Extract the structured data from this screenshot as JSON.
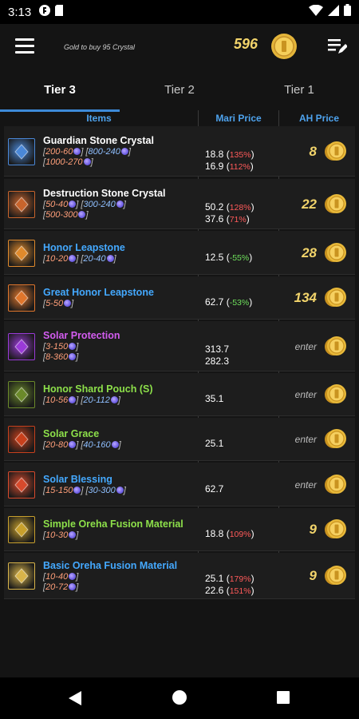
{
  "status": {
    "time": "3:13"
  },
  "header": {
    "subtitle": "Gold to buy 95 Crystal",
    "gold": "596"
  },
  "tabs": [
    {
      "label": "Tier 3",
      "active": true
    },
    {
      "label": "Tier 2",
      "active": false
    },
    {
      "label": "Tier 1",
      "active": false
    }
  ],
  "columns": {
    "items": "Items",
    "mari": "Mari Price",
    "ah": "AH Price"
  },
  "rows": [
    {
      "name": "Guardian Stone Crystal",
      "name_color": "#ffffff",
      "icon": "guardian-stone-crystal-icon",
      "icon_color": "#4a88d8",
      "exch": [
        {
          "a": "200-60",
          "b": "800-240"
        },
        {
          "a": "1000-270",
          "b": ""
        }
      ],
      "mari": [
        {
          "v": "18.8",
          "p": "135%",
          "c": "red"
        },
        {
          "v": "16.9",
          "p": "112%",
          "c": "red"
        }
      ],
      "ah": "8"
    },
    {
      "name": "Destruction Stone Crystal",
      "name_color": "#ffffff",
      "icon": "destruction-stone-crystal-icon",
      "icon_color": "#c8642c",
      "exch": [
        {
          "a": "50-40",
          "b": "300-240"
        },
        {
          "a": "500-300",
          "b": ""
        }
      ],
      "mari": [
        {
          "v": "50.2",
          "p": "128%",
          "c": "red"
        },
        {
          "v": "37.6",
          "p": "71%",
          "c": "red"
        }
      ],
      "ah": "22"
    },
    {
      "name": "Honor Leapstone",
      "name_color": "#44a9ff",
      "icon": "honor-leapstone-icon",
      "icon_color": "#e08a2c",
      "exch": [
        {
          "a": "10-20",
          "b": "20-40"
        }
      ],
      "mari": [
        {
          "v": "12.5",
          "p": "-55%",
          "c": "green"
        }
      ],
      "ah": "28"
    },
    {
      "name": "Great Honor Leapstone",
      "name_color": "#44a9ff",
      "icon": "great-honor-leapstone-icon",
      "icon_color": "#e0762c",
      "exch": [
        {
          "a": "5-50",
          "b": ""
        }
      ],
      "mari": [
        {
          "v": "62.7",
          "p": "-53%",
          "c": "green"
        }
      ],
      "ah": "134"
    },
    {
      "name": "Solar Protection",
      "name_color": "#d35cf0",
      "icon": "solar-protection-icon",
      "icon_color": "#9a3ad8",
      "exch": [
        {
          "a": "3-150",
          "b": ""
        },
        {
          "a": "8-360",
          "b": ""
        }
      ],
      "mari": [
        {
          "v": "313.7",
          "p": "",
          "c": ""
        },
        {
          "v": "282.3",
          "p": "",
          "c": ""
        }
      ],
      "ah": "enter"
    },
    {
      "name": "Honor Shard Pouch (S)",
      "name_color": "#8de04a",
      "icon": "honor-shard-pouch-icon",
      "icon_color": "#6b8a2a",
      "exch": [
        {
          "a": "10-56",
          "b": "20-112"
        }
      ],
      "mari": [
        {
          "v": "35.1",
          "p": "",
          "c": ""
        }
      ],
      "ah": "enter"
    },
    {
      "name": "Solar Grace",
      "name_color": "#8de04a",
      "icon": "solar-grace-icon",
      "icon_color": "#c8401c",
      "exch": [
        {
          "a": "20-80",
          "b": "40-160"
        }
      ],
      "mari": [
        {
          "v": "25.1",
          "p": "",
          "c": ""
        }
      ],
      "ah": "enter"
    },
    {
      "name": "Solar Blessing",
      "name_color": "#44a9ff",
      "icon": "solar-blessing-icon",
      "icon_color": "#d84a2c",
      "exch": [
        {
          "a": "15-150",
          "b": "30-300"
        }
      ],
      "mari": [
        {
          "v": "62.7",
          "p": "",
          "c": ""
        }
      ],
      "ah": "enter"
    },
    {
      "name": "Simple Oreha Fusion Material",
      "name_color": "#8de04a",
      "icon": "simple-oreha-fusion-icon",
      "icon_color": "#c8a02c",
      "exch": [
        {
          "a": "10-30",
          "b": ""
        }
      ],
      "mari": [
        {
          "v": "18.8",
          "p": "109%",
          "c": "red"
        }
      ],
      "ah": "9"
    },
    {
      "name": "Basic Oreha Fusion Material",
      "name_color": "#44a9ff",
      "icon": "basic-oreha-fusion-icon",
      "icon_color": "#d8b44a",
      "exch": [
        {
          "a": "10-40",
          "b": ""
        },
        {
          "a": "20-72",
          "b": ""
        }
      ],
      "mari": [
        {
          "v": "25.1",
          "p": "179%",
          "c": "red"
        },
        {
          "v": "22.6",
          "p": "151%",
          "c": "red"
        }
      ],
      "ah": "9"
    }
  ]
}
